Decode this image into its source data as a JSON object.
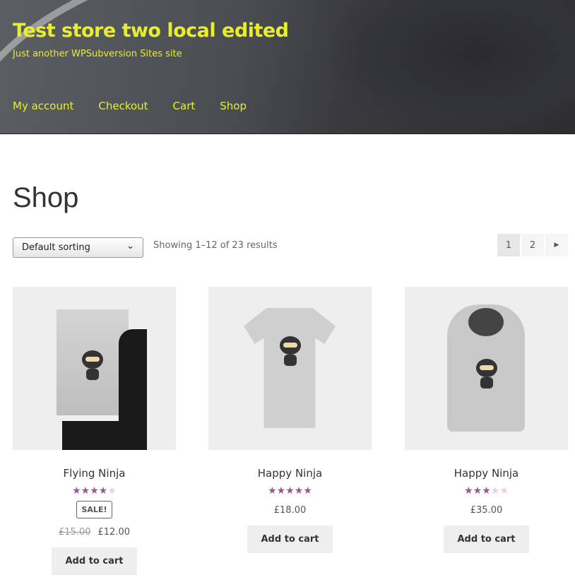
{
  "header": {
    "title": "Test store two local edited",
    "tagline": "Just another WPSubversion Sites site",
    "nav": [
      "My account",
      "Checkout",
      "Cart",
      "Shop"
    ],
    "accent": "#e8ee2b"
  },
  "page": {
    "title": "Shop"
  },
  "toolbar": {
    "sort": "Default sorting",
    "result_count": "Showing 1–12 of 23 results",
    "pages": [
      "1",
      "2"
    ],
    "current_page": "1",
    "next_icon": "triangle-right-icon"
  },
  "products": [
    {
      "name": "Flying Ninja",
      "rating": 4,
      "sale_badge": "SALE!",
      "old_price": "£15.00",
      "price": "£12.00",
      "button": "Add to cart"
    },
    {
      "name": "Happy Ninja",
      "rating": 5,
      "price": "£18.00",
      "button": "Add to cart"
    },
    {
      "name": "Happy Ninja",
      "rating": 3,
      "price": "£35.00",
      "button": "Add to cart"
    }
  ],
  "star_color": "#96588a"
}
